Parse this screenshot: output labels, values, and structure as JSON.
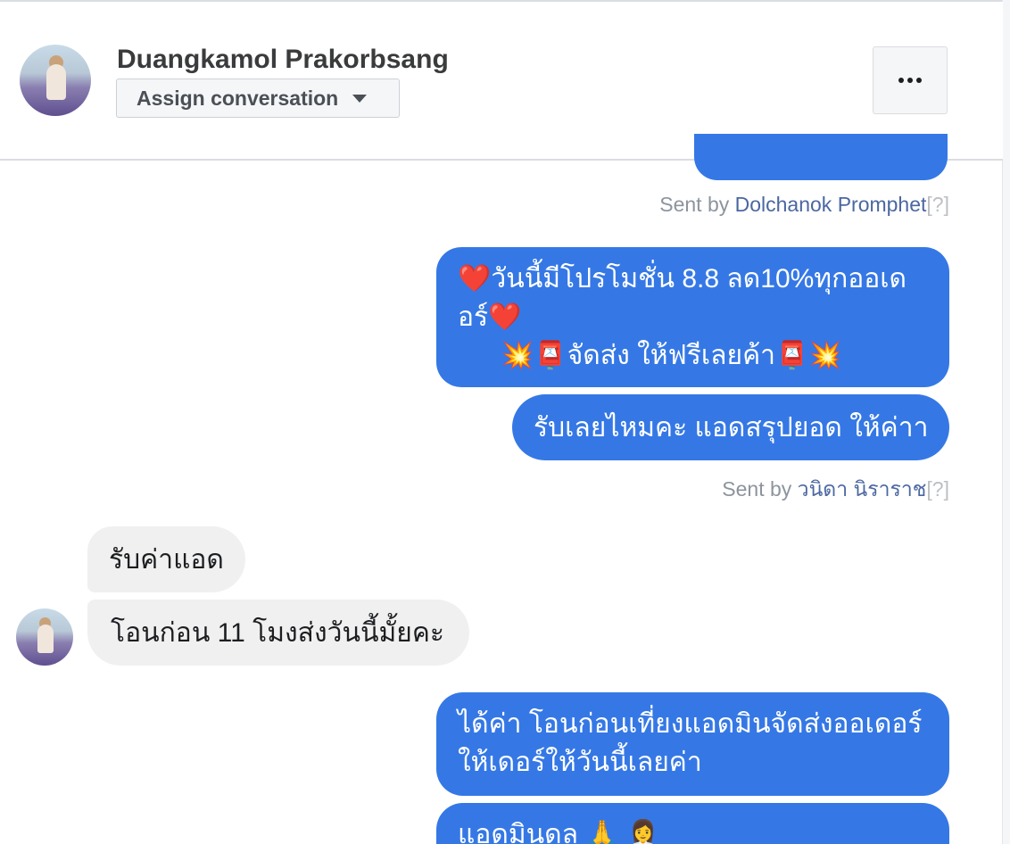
{
  "conversation": {
    "contact_name": "Duangkamol Prakorbsang",
    "assign_label": "Assign conversation",
    "more_icon": "more-horizontal-icon"
  },
  "messages": {
    "sent_by_1": {
      "prefix": "Sent by ",
      "name": "Dolchanok Promphet",
      "q": "[?]"
    },
    "promo": {
      "line1": "วันนี้มีโปรโมชั่น 8.8 ลด10%ทุกออเด",
      "line2": "อร์",
      "line3": "จัดส่ง ให้ฟรีเลยค้า",
      "emoji_heart": "❤️",
      "emoji_boom": "💥",
      "emoji_mailbox": "📮"
    },
    "accept": "รับเลยไหมคะ แอดสรุปยอด ให้ค่าา",
    "sent_by_2": {
      "prefix": "Sent by ",
      "name": "วนิดา นิราราช",
      "q": "[?]"
    },
    "incoming_1": "รับค่าแอด",
    "incoming_2": "โอนก่อน 11 โมงส่งวันนี้มั้ยคะ",
    "reply": {
      "line1": "ได้ค่า โอนก่อนเที่ยงแอดมินจัดส่งออเดอร์",
      "line2": "ให้เดอร์ให้วันนี้เลยค่า"
    },
    "last": {
      "text": "แอดมินดล",
      "emoji_pray": "🙏",
      "emoji_person": "👩‍💼"
    }
  },
  "colors": {
    "outgoing_bubble": "#3578e5",
    "incoming_bubble": "#f0f0f0",
    "sender_link": "#4b67a1"
  }
}
